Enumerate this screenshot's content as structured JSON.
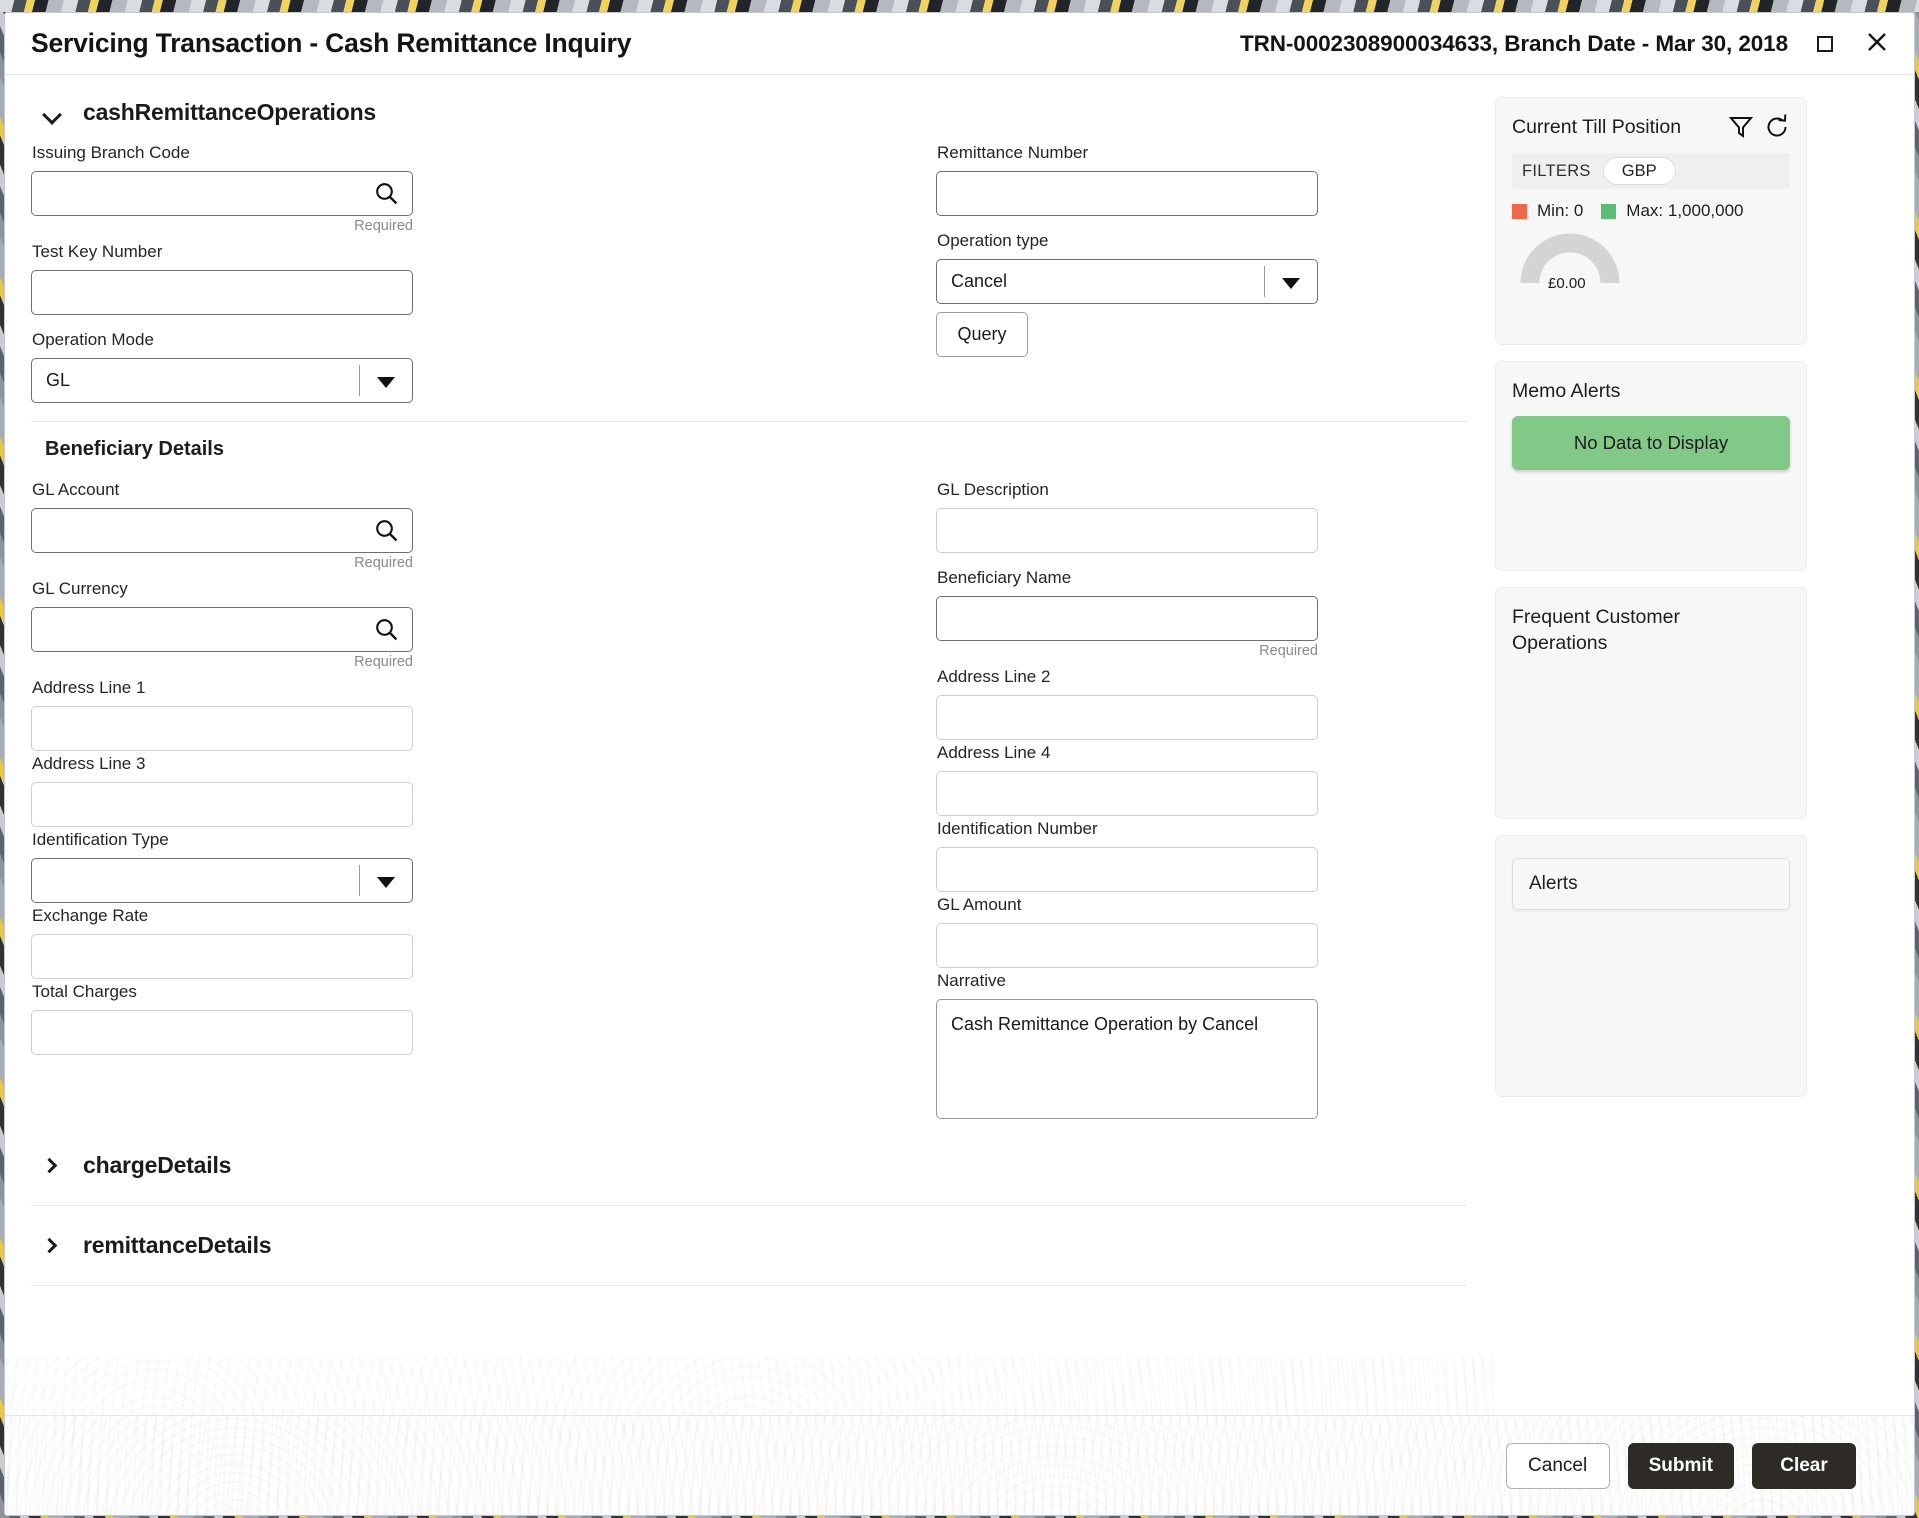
{
  "header": {
    "title": "Servicing Transaction - Cash Remittance Inquiry",
    "transaction_ref": "TRN-0002308900034633, Branch Date - Mar 30, 2018",
    "minimize_icon": "collapse-corners-icon",
    "close_icon": "close-icon"
  },
  "sections": {
    "main": {
      "title": "cashRemittanceOperations",
      "expanded": true,
      "fields": {
        "issuing_branch_code": {
          "label": "Issuing Branch Code",
          "value": "",
          "helper": "Required",
          "icon": "search-icon"
        },
        "test_key_number": {
          "label": "Test Key Number",
          "value": ""
        },
        "operation_mode": {
          "label": "Operation Mode",
          "value": "GL"
        },
        "remittance_number": {
          "label": "Remittance Number",
          "value": ""
        },
        "operation_type": {
          "label": "Operation type",
          "value": "Cancel"
        }
      },
      "query_button": "Query"
    },
    "beneficiary": {
      "title": "Beneficiary Details",
      "fields": {
        "gl_account": {
          "label": "GL Account",
          "value": "",
          "helper": "Required",
          "icon": "search-icon"
        },
        "gl_currency": {
          "label": "GL Currency",
          "value": "",
          "helper": "Required",
          "icon": "search-icon"
        },
        "address_line_1": {
          "label": "Address Line 1",
          "value": ""
        },
        "address_line_3": {
          "label": "Address Line 3",
          "value": ""
        },
        "identification_type": {
          "label": "Identification Type",
          "value": ""
        },
        "exchange_rate": {
          "label": "Exchange Rate",
          "value": ""
        },
        "total_charges": {
          "label": "Total Charges",
          "value": ""
        },
        "gl_description": {
          "label": "GL Description",
          "value": ""
        },
        "beneficiary_name": {
          "label": "Beneficiary Name",
          "value": "",
          "helper": "Required"
        },
        "address_line_2": {
          "label": "Address Line 2",
          "value": ""
        },
        "address_line_4": {
          "label": "Address Line 4",
          "value": ""
        },
        "identification_number": {
          "label": "Identification Number",
          "value": ""
        },
        "gl_amount": {
          "label": "GL Amount",
          "value": ""
        },
        "narrative": {
          "label": "Narrative",
          "value": "Cash Remittance Operation by Cancel"
        }
      }
    },
    "charge_details": {
      "title": "chargeDetails",
      "expanded": false
    },
    "remittance_details": {
      "title": "remittanceDetails",
      "expanded": false
    }
  },
  "rail": {
    "till": {
      "title": "Current Till Position",
      "filter_icon": "funnel-icon",
      "refresh_icon": "refresh-icon",
      "filters_label": "FILTERS",
      "currency": "GBP",
      "min_label": "Min: 0",
      "max_label": "Max: 1,000,000",
      "min_color": "#ef6a4a",
      "max_color": "#5bbd73",
      "gauge_value": "£0.00",
      "gauge_track_color": "#d4d4d4"
    },
    "memo": {
      "title": "Memo Alerts",
      "banner_text": "No Data to Display",
      "banner_color": "#82c887"
    },
    "frequent": {
      "title": "Frequent Customer Operations"
    },
    "alerts": {
      "title": "Alerts"
    }
  },
  "footer": {
    "cancel": "Cancel",
    "submit": "Submit",
    "clear": "Clear"
  }
}
